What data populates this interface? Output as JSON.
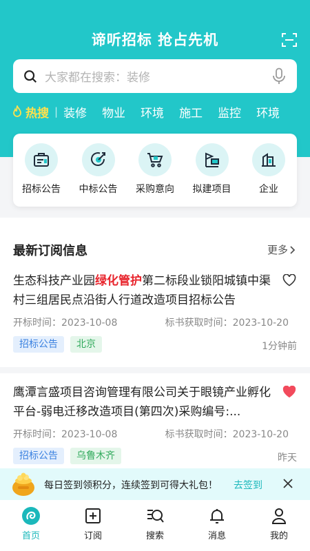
{
  "header": {
    "slogan": "谛听招标 抢占先机",
    "scan_icon": "scan-icon"
  },
  "search": {
    "placeholder": "大家都在搜索：装修",
    "search_icon": "search-icon",
    "mic_icon": "microphone-icon"
  },
  "hot": {
    "label": "热搜",
    "separator": "|",
    "keywords": [
      "装修",
      "物业",
      "环境",
      "施工",
      "监控",
      "环境"
    ]
  },
  "categories": [
    {
      "label": "招标公告",
      "icon": "bid-notice-icon"
    },
    {
      "label": "中标公告",
      "icon": "award-notice-icon"
    },
    {
      "label": "采购意向",
      "icon": "shopping-cart-icon"
    },
    {
      "label": "拟建项目",
      "icon": "crane-icon"
    },
    {
      "label": "企业",
      "icon": "building-icon"
    }
  ],
  "section": {
    "title": "最新订阅信息",
    "more": "更多"
  },
  "items": [
    {
      "title_before": "生态科技产业园",
      "title_highlight": "绿化管护",
      "title_after": "第二标段业锁阳城镇中渠村三组居民点沿街人行道改造项目招标公告",
      "open_label": "开标时间：2023-10-08",
      "doc_label": "标书获取时间：2023-10-20",
      "tags": [
        "招标公告",
        "北京"
      ],
      "time": "1分钟前",
      "favorited": false
    },
    {
      "title_before": "鹰潭言盛项目咨询管理有限公司关于眼镜产业孵化平台-弱电迁移改造项目(第四次)采购编号:...",
      "title_highlight": "",
      "title_after": "",
      "open_label": "开标时间：2023-10-08",
      "doc_label": "标书获取时间：2023-10-20",
      "tags": [
        "招标公告",
        "乌鲁木齐"
      ],
      "time": "昨天",
      "favorited": true
    }
  ],
  "banner": {
    "text": "每日签到领积分，连续签到可得大礼包！",
    "button": "去签到"
  },
  "tabs": [
    {
      "label": "首页",
      "icon": "home-icon",
      "active": true
    },
    {
      "label": "订阅",
      "icon": "subscribe-icon",
      "active": false
    },
    {
      "label": "搜索",
      "icon": "search-list-icon",
      "active": false
    },
    {
      "label": "消息",
      "icon": "bell-icon",
      "active": false
    },
    {
      "label": "我的",
      "icon": "user-icon",
      "active": false
    }
  ],
  "colors": {
    "brand": "#22c7c9",
    "highlight": "#e8242c",
    "hot_label": "#ffe14d",
    "favorite": "#f24a5c"
  }
}
